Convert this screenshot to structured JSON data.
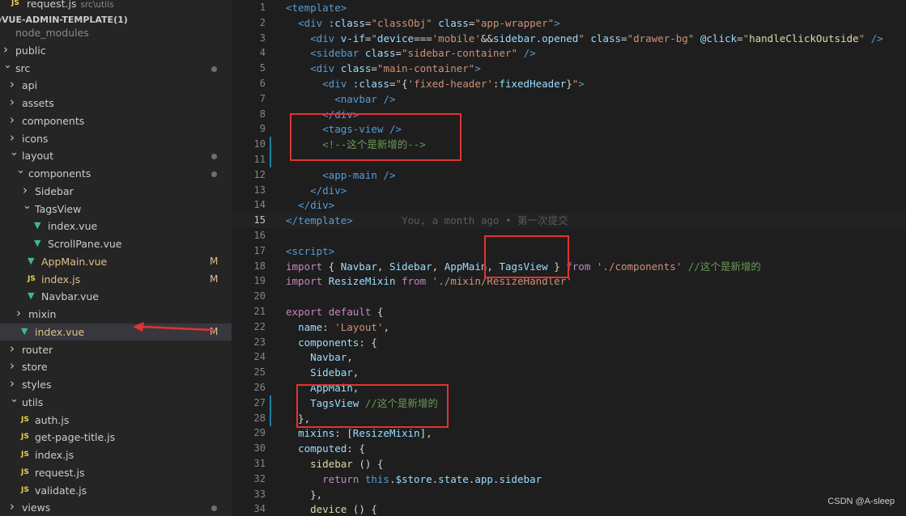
{
  "explorer": {
    "open_file_top": {
      "name": "request.js",
      "desc": "src\\utils"
    },
    "project_title": "VUE-ADMIN-TEMPLATE(1)",
    "rows": [
      {
        "label": "node_modules",
        "type": "folder",
        "depth": 0,
        "chevron": "",
        "muted": true
      },
      {
        "label": "public",
        "type": "folder",
        "depth": 0,
        "chevron": ">"
      },
      {
        "label": "src",
        "type": "folder",
        "depth": 0,
        "chevron": "v",
        "dot": true,
        "mod": true
      },
      {
        "label": "api",
        "type": "folder",
        "depth": 1,
        "chevron": ">"
      },
      {
        "label": "assets",
        "type": "folder",
        "depth": 1,
        "chevron": ">"
      },
      {
        "label": "components",
        "type": "folder",
        "depth": 1,
        "chevron": ">"
      },
      {
        "label": "icons",
        "type": "folder",
        "depth": 1,
        "chevron": ">"
      },
      {
        "label": "layout",
        "type": "folder",
        "depth": 1,
        "chevron": "v",
        "dot": true,
        "mod": true
      },
      {
        "label": "components",
        "type": "folder",
        "depth": 2,
        "chevron": "v",
        "dot": true,
        "mod": true
      },
      {
        "label": "Sidebar",
        "type": "folder",
        "depth": 3,
        "chevron": ">"
      },
      {
        "label": "TagsView",
        "type": "folder",
        "depth": 3,
        "chevron": "v"
      },
      {
        "label": "index.vue",
        "type": "vue",
        "depth": 4
      },
      {
        "label": "ScrollPane.vue",
        "type": "vue",
        "depth": 4
      },
      {
        "label": "AppMain.vue",
        "type": "vue",
        "depth": 3,
        "badge": "M",
        "mod": true
      },
      {
        "label": "index.js",
        "type": "js",
        "depth": 3,
        "badge": "M",
        "mod": true
      },
      {
        "label": "Navbar.vue",
        "type": "vue",
        "depth": 3
      },
      {
        "label": "mixin",
        "type": "folder",
        "depth": 2,
        "chevron": ">"
      },
      {
        "label": "index.vue",
        "type": "vue",
        "depth": 2,
        "badge": "M",
        "mod": true,
        "selected": true
      },
      {
        "label": "router",
        "type": "folder",
        "depth": 1,
        "chevron": ">"
      },
      {
        "label": "store",
        "type": "folder",
        "depth": 1,
        "chevron": ">"
      },
      {
        "label": "styles",
        "type": "folder",
        "depth": 1,
        "chevron": ">"
      },
      {
        "label": "utils",
        "type": "folder",
        "depth": 1,
        "chevron": "v"
      },
      {
        "label": "auth.js",
        "type": "js",
        "depth": 2
      },
      {
        "label": "get-page-title.js",
        "type": "js",
        "depth": 2
      },
      {
        "label": "index.js",
        "type": "js",
        "depth": 2
      },
      {
        "label": "request.js",
        "type": "js",
        "depth": 2
      },
      {
        "label": "validate.js",
        "type": "js",
        "depth": 2
      },
      {
        "label": "views",
        "type": "folder",
        "depth": 1,
        "chevron": ">",
        "dot": true,
        "mod": true
      }
    ],
    "icons": {
      "js": "JS",
      "vue": "▼"
    },
    "badge_color": "#e2c08d"
  },
  "editor": {
    "current_line": 15,
    "blame_text": "You, a month ago • 第一次提交",
    "lines": [
      {
        "n": 1,
        "tokens": [
          [
            "t-tag",
            "<template>"
          ]
        ]
      },
      {
        "n": 2,
        "tokens": [
          [
            "t-pl",
            "  "
          ],
          [
            "t-tag",
            "<div"
          ],
          [
            "t-pl",
            " "
          ],
          [
            "t-attr",
            ":class"
          ],
          [
            "t-pl",
            "="
          ],
          [
            "t-str",
            "\"classObj\""
          ],
          [
            "t-pl",
            " "
          ],
          [
            "t-attr",
            "class"
          ],
          [
            "t-pl",
            "="
          ],
          [
            "t-str",
            "\"app-wrapper\""
          ],
          [
            "t-tag",
            ">"
          ]
        ]
      },
      {
        "n": 3,
        "tokens": [
          [
            "t-pl",
            "    "
          ],
          [
            "t-tag",
            "<div"
          ],
          [
            "t-pl",
            " "
          ],
          [
            "t-attr",
            "v-if"
          ],
          [
            "t-pl",
            "="
          ],
          [
            "t-str",
            "\""
          ],
          [
            "t-prop",
            "device"
          ],
          [
            "t-pl",
            "==="
          ],
          [
            "t-str",
            "'mobile'"
          ],
          [
            "t-pl",
            "&&"
          ],
          [
            "t-prop",
            "sidebar"
          ],
          [
            "t-pl",
            "."
          ],
          [
            "t-prop",
            "opened"
          ],
          [
            "t-str",
            "\""
          ],
          [
            "t-pl",
            " "
          ],
          [
            "t-attr",
            "class"
          ],
          [
            "t-pl",
            "="
          ],
          [
            "t-str",
            "\"drawer-bg\""
          ],
          [
            "t-pl",
            " "
          ],
          [
            "t-attr",
            "@click"
          ],
          [
            "t-pl",
            "="
          ],
          [
            "t-str",
            "\""
          ],
          [
            "t-fn",
            "handleClickOutside"
          ],
          [
            "t-str",
            "\""
          ],
          [
            "t-pl",
            " "
          ],
          [
            "t-tag",
            "/>"
          ]
        ]
      },
      {
        "n": 4,
        "tokens": [
          [
            "t-pl",
            "    "
          ],
          [
            "t-tag",
            "<sidebar"
          ],
          [
            "t-pl",
            " "
          ],
          [
            "t-attr",
            "class"
          ],
          [
            "t-pl",
            "="
          ],
          [
            "t-str",
            "\"sidebar-container\""
          ],
          [
            "t-pl",
            " "
          ],
          [
            "t-tag",
            "/>"
          ]
        ]
      },
      {
        "n": 5,
        "tokens": [
          [
            "t-pl",
            "    "
          ],
          [
            "t-tag",
            "<div"
          ],
          [
            "t-pl",
            " "
          ],
          [
            "t-attr",
            "class"
          ],
          [
            "t-pl",
            "="
          ],
          [
            "t-str",
            "\"main-container\""
          ],
          [
            "t-tag",
            ">"
          ]
        ]
      },
      {
        "n": 6,
        "tokens": [
          [
            "t-pl",
            "      "
          ],
          [
            "t-tag",
            "<div"
          ],
          [
            "t-pl",
            " "
          ],
          [
            "t-attr",
            ":class"
          ],
          [
            "t-pl",
            "="
          ],
          [
            "t-str",
            "\""
          ],
          [
            "t-pl",
            "{"
          ],
          [
            "t-str",
            "'fixed-header'"
          ],
          [
            "t-pl",
            ":"
          ],
          [
            "t-prop",
            "fixedHeader"
          ],
          [
            "t-pl",
            "}"
          ],
          [
            "t-str",
            "\""
          ],
          [
            "t-tag",
            ">"
          ]
        ]
      },
      {
        "n": 7,
        "tokens": [
          [
            "t-pl",
            "        "
          ],
          [
            "t-tag",
            "<navbar"
          ],
          [
            "t-pl",
            " "
          ],
          [
            "t-tag",
            "/>"
          ]
        ]
      },
      {
        "n": 8,
        "tokens": [
          [
            "t-pl",
            "      "
          ],
          [
            "t-tag",
            "</div>"
          ]
        ]
      },
      {
        "n": 9,
        "tokens": [
          [
            "t-pl",
            "      "
          ],
          [
            "t-tag",
            "<tags-view"
          ],
          [
            "t-pl",
            " "
          ],
          [
            "t-tag",
            "/>"
          ]
        ]
      },
      {
        "n": 10,
        "tokens": [
          [
            "t-pl",
            "      "
          ],
          [
            "t-cm",
            "<!--这个是新增的-->"
          ]
        ],
        "mark": true
      },
      {
        "n": 11,
        "tokens": [],
        "mark": true
      },
      {
        "n": 12,
        "tokens": [
          [
            "t-pl",
            "      "
          ],
          [
            "t-tag",
            "<app-main"
          ],
          [
            "t-pl",
            " "
          ],
          [
            "t-tag",
            "/>"
          ]
        ]
      },
      {
        "n": 13,
        "tokens": [
          [
            "t-pl",
            "    "
          ],
          [
            "t-tag",
            "</div>"
          ]
        ]
      },
      {
        "n": 14,
        "tokens": [
          [
            "t-pl",
            "  "
          ],
          [
            "t-tag",
            "</div>"
          ]
        ]
      },
      {
        "n": 15,
        "tokens": [
          [
            "t-tag",
            "</template>"
          ]
        ],
        "blame": true
      },
      {
        "n": 16,
        "tokens": []
      },
      {
        "n": 17,
        "tokens": [
          [
            "t-tag",
            "<script>"
          ]
        ]
      },
      {
        "n": 18,
        "tokens": [
          [
            "t-kw",
            "import"
          ],
          [
            "t-pl",
            " { "
          ],
          [
            "t-prop",
            "Navbar"
          ],
          [
            "t-pl",
            ", "
          ],
          [
            "t-prop",
            "Sidebar"
          ],
          [
            "t-pl",
            ", "
          ],
          [
            "t-prop",
            "AppMain"
          ],
          [
            "t-pl",
            ", "
          ],
          [
            "t-prop",
            "TagsView"
          ],
          [
            "t-pl",
            " } "
          ],
          [
            "t-kw",
            "from"
          ],
          [
            "t-pl",
            " "
          ],
          [
            "t-str",
            "'./components'"
          ],
          [
            "t-pl",
            " "
          ],
          [
            "t-cm",
            "//这个是新增的"
          ]
        ]
      },
      {
        "n": 19,
        "tokens": [
          [
            "t-kw",
            "import"
          ],
          [
            "t-pl",
            " "
          ],
          [
            "t-prop",
            "ResizeMixin"
          ],
          [
            "t-pl",
            " "
          ],
          [
            "t-kw",
            "from"
          ],
          [
            "t-pl",
            " "
          ],
          [
            "t-str",
            "'./mixin/ResizeHandler'"
          ]
        ]
      },
      {
        "n": 20,
        "tokens": []
      },
      {
        "n": 21,
        "tokens": [
          [
            "t-kw",
            "export"
          ],
          [
            "t-pl",
            " "
          ],
          [
            "t-kw",
            "default"
          ],
          [
            "t-pl",
            " {"
          ]
        ]
      },
      {
        "n": 22,
        "tokens": [
          [
            "t-pl",
            "  "
          ],
          [
            "t-prop",
            "name"
          ],
          [
            "t-pl",
            ": "
          ],
          [
            "t-str",
            "'Layout'"
          ],
          [
            "t-pl",
            ","
          ]
        ]
      },
      {
        "n": 23,
        "tokens": [
          [
            "t-pl",
            "  "
          ],
          [
            "t-prop",
            "components"
          ],
          [
            "t-pl",
            ": {"
          ]
        ]
      },
      {
        "n": 24,
        "tokens": [
          [
            "t-pl",
            "    "
          ],
          [
            "t-prop",
            "Navbar"
          ],
          [
            "t-pl",
            ","
          ]
        ]
      },
      {
        "n": 25,
        "tokens": [
          [
            "t-pl",
            "    "
          ],
          [
            "t-prop",
            "Sidebar"
          ],
          [
            "t-pl",
            ","
          ]
        ]
      },
      {
        "n": 26,
        "tokens": [
          [
            "t-pl",
            "    "
          ],
          [
            "t-prop",
            "AppMain"
          ],
          [
            "t-pl",
            ","
          ]
        ]
      },
      {
        "n": 27,
        "tokens": [
          [
            "t-pl",
            "    "
          ],
          [
            "t-prop",
            "TagsView"
          ],
          [
            "t-pl",
            " "
          ],
          [
            "t-cm",
            "//这个是新增的"
          ]
        ],
        "mark": true
      },
      {
        "n": 28,
        "tokens": [
          [
            "t-pl",
            "  },"
          ]
        ],
        "mark": true
      },
      {
        "n": 29,
        "tokens": [
          [
            "t-pl",
            "  "
          ],
          [
            "t-prop",
            "mixins"
          ],
          [
            "t-pl",
            ": ["
          ],
          [
            "t-prop",
            "ResizeMixin"
          ],
          [
            "t-pl",
            "],"
          ]
        ]
      },
      {
        "n": 30,
        "tokens": [
          [
            "t-pl",
            "  "
          ],
          [
            "t-prop",
            "computed"
          ],
          [
            "t-pl",
            ": {"
          ]
        ]
      },
      {
        "n": 31,
        "tokens": [
          [
            "t-pl",
            "    "
          ],
          [
            "t-fn",
            "sidebar"
          ],
          [
            "t-pl",
            " () {"
          ]
        ]
      },
      {
        "n": 32,
        "tokens": [
          [
            "t-pl",
            "      "
          ],
          [
            "t-kw",
            "return"
          ],
          [
            "t-pl",
            " "
          ],
          [
            "t-blue",
            "this"
          ],
          [
            "t-pl",
            "."
          ],
          [
            "t-prop",
            "$store"
          ],
          [
            "t-pl",
            "."
          ],
          [
            "t-prop",
            "state"
          ],
          [
            "t-pl",
            "."
          ],
          [
            "t-prop",
            "app"
          ],
          [
            "t-pl",
            "."
          ],
          [
            "t-prop",
            "sidebar"
          ]
        ]
      },
      {
        "n": 33,
        "tokens": [
          [
            "t-pl",
            "    },"
          ]
        ]
      },
      {
        "n": 34,
        "tokens": [
          [
            "t-pl",
            "    "
          ],
          [
            "t-fn",
            "device"
          ],
          [
            "t-pl",
            " () {"
          ]
        ]
      }
    ]
  },
  "watermark": "CSDN @A-sleep"
}
